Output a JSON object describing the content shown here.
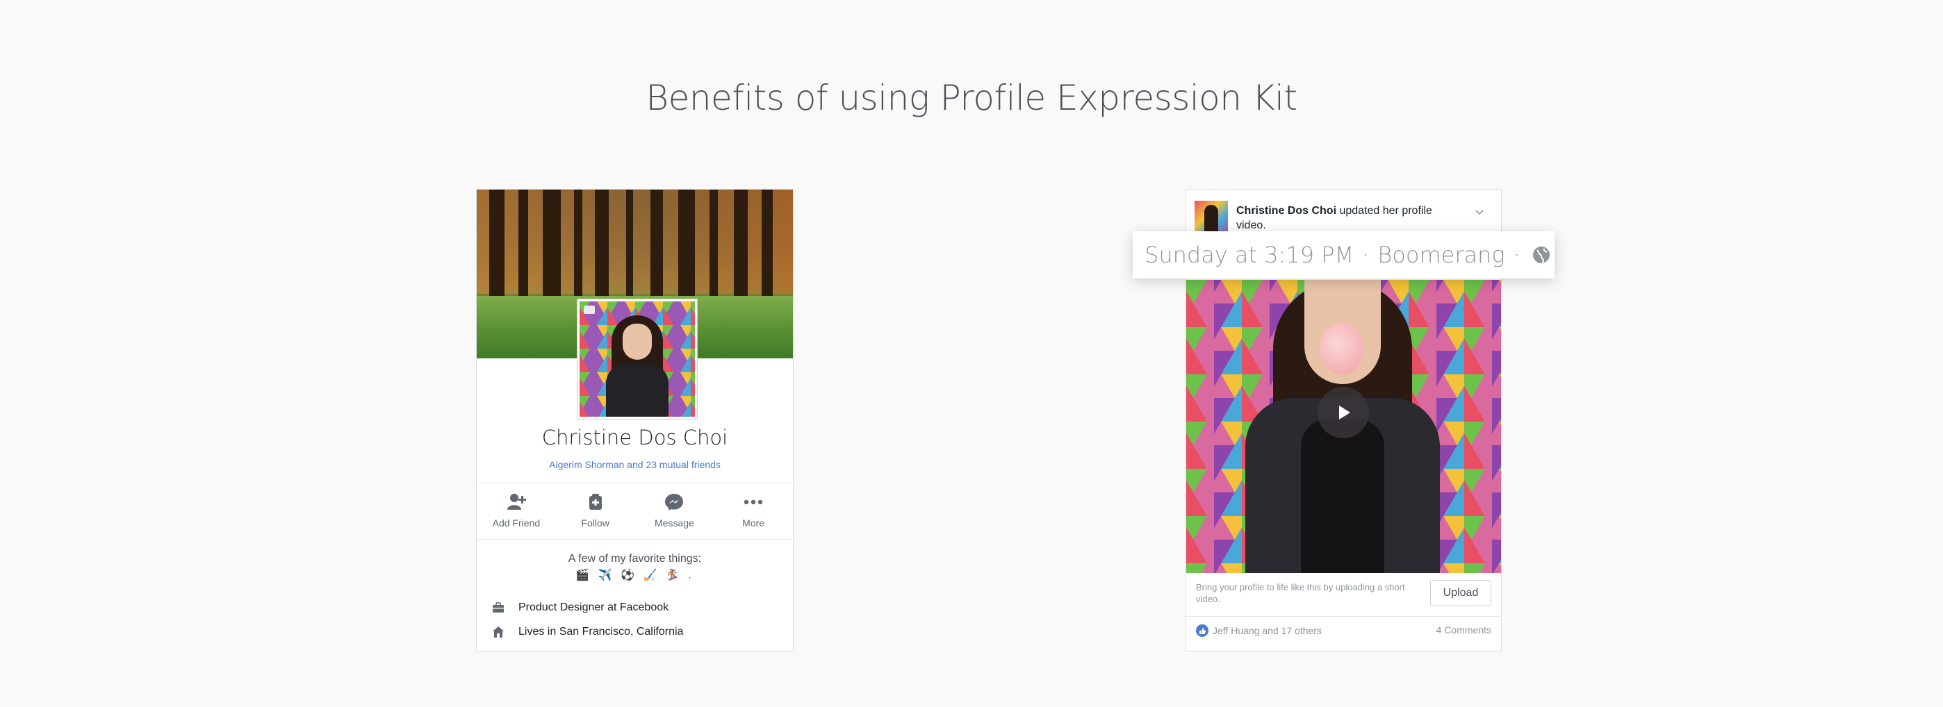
{
  "page": {
    "title": "Benefits of using Profile Expression Kit"
  },
  "profile_card": {
    "name": "Christine Dos Choi",
    "mutual_friends": "Aigerim Shorman and 23 mutual friends",
    "actions": [
      {
        "label": "Add Friend",
        "icon": "add-friend-icon"
      },
      {
        "label": "Follow",
        "icon": "follow-icon"
      },
      {
        "label": "Message",
        "icon": "messenger-icon"
      },
      {
        "label": "More",
        "icon": "more-icon"
      }
    ],
    "favorites_title": "A few of my favorite things:",
    "favorites_emoji": "🎬 ✈️ ⚽ 🏑 🏂 .",
    "info": [
      {
        "icon": "briefcase-icon",
        "text": "Product Designer at Facebook"
      },
      {
        "icon": "home-icon",
        "text": "Lives in San Francisco, California"
      }
    ]
  },
  "post_card": {
    "author": "Christine Dos Choi",
    "action_text": "updated her profile video.",
    "timestamp": {
      "time": "Sunday at 3:19 PM",
      "separator": "·",
      "source": "Boomerang",
      "audience_icon": "globe-icon"
    },
    "upload_prompt": "Bring your profile to life like this by uploading a short video.",
    "upload_button": "Upload",
    "likes_text": "Jeff Huang and 17 others",
    "comments_text": "4 Comments"
  },
  "colors": {
    "background": "#f9f9f9",
    "link_blue": "#4a7bd0",
    "text_dark": "#1d2129",
    "text_muted": "#90949c"
  }
}
